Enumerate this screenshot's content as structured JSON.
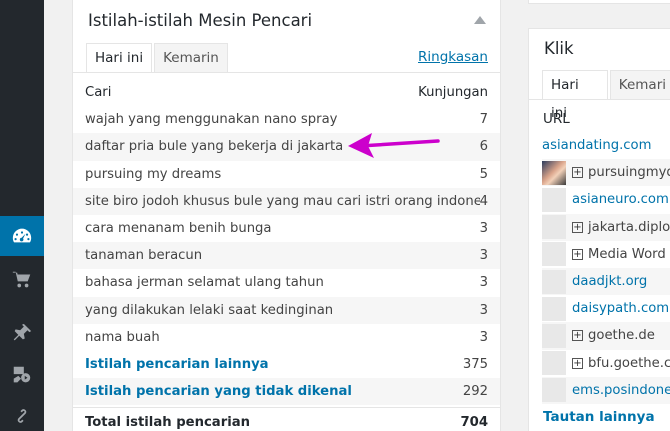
{
  "sidebar": {
    "icons": [
      "dashboard-icon",
      "cart-icon",
      "pin-icon",
      "media-icon",
      "link-icon"
    ],
    "active": "dashboard-icon",
    "accent_color": "#0073aa"
  },
  "search_terms": {
    "title": "Istilah-istilah Mesin Pencari",
    "tabs": [
      "Hari ini",
      "Kemarin"
    ],
    "active_tab": "Hari ini",
    "summary_link": "Ringkasan",
    "columns": [
      "Cari",
      "Kunjungan"
    ],
    "rows": [
      {
        "term": "wajah yang menggunakan nano spray",
        "visits": "7"
      },
      {
        "term": "daftar pria bule yang bekerja di jakarta",
        "visits": "6"
      },
      {
        "term": "pursuing my dreams",
        "visits": "5"
      },
      {
        "term": "site biro jodoh khusus bule yang mau cari istri orang indonesia",
        "visits": "4"
      },
      {
        "term": "cara menanam benih bunga",
        "visits": "3"
      },
      {
        "term": "tanaman beracun",
        "visits": "3"
      },
      {
        "term": "bahasa jerman selamat ulang tahun",
        "visits": "3"
      },
      {
        "term": "yang dilakukan lelaki saat kedinginan",
        "visits": "3"
      },
      {
        "term": "nama buah",
        "visits": "3"
      }
    ],
    "other_terms": {
      "label": "Istilah pencarian lainnya",
      "visits": "375"
    },
    "unknown_terms": {
      "label": "Istilah pencarian yang tidak dikenal",
      "visits": "292"
    },
    "total": {
      "label": "Total istilah pencarian",
      "visits": "704"
    },
    "arrow_color": "#cc00cc"
  },
  "clicks": {
    "title": "Klik",
    "tabs": [
      "Hari ini",
      "Kemari"
    ],
    "url_header": "URL",
    "urls": [
      {
        "text": "asiandating.com",
        "type": "link",
        "expander": false,
        "avatar": false
      },
      {
        "text": "pursuingmydr",
        "type": "plain",
        "expander": true,
        "avatar": true
      },
      {
        "text": "asianeuro.com",
        "type": "link",
        "expander": false,
        "avatar": false
      },
      {
        "text": "jakarta.diplo",
        "type": "plain",
        "expander": true,
        "avatar": false
      },
      {
        "text": "Media Word",
        "type": "plain",
        "expander": true,
        "avatar": false
      },
      {
        "text": "daadjkt.org",
        "type": "link",
        "expander": false,
        "avatar": false
      },
      {
        "text": "daisypath.com",
        "type": "link",
        "expander": false,
        "avatar": false
      },
      {
        "text": "goethe.de",
        "type": "plain",
        "expander": true,
        "avatar": false
      },
      {
        "text": "bfu.goethe.c",
        "type": "plain",
        "expander": true,
        "avatar": false
      },
      {
        "text": "ems.posindone",
        "type": "link",
        "expander": false,
        "avatar": false
      }
    ],
    "more_link": "Tautan lainnya"
  }
}
